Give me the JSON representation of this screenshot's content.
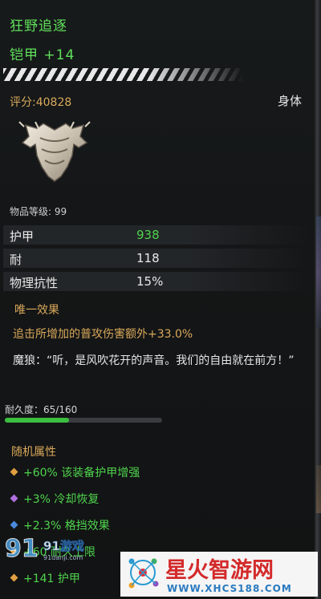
{
  "item": {
    "name": "狂野追逐",
    "subtype": "铠甲 +14",
    "score": "评分:40828",
    "slot": "身体",
    "item_level": "物品等级: 99"
  },
  "stats": [
    {
      "label": "护甲",
      "value": "938",
      "color": "#4fd44d"
    },
    {
      "label": "耐",
      "value": "118",
      "color": "#e8e8e8"
    },
    {
      "label": "物理抗性",
      "value": "15%",
      "color": "#e8e8e8"
    }
  ],
  "unique": {
    "header": "唯一效果",
    "effect": "追击所增加的普攻伤害额外+33.0%",
    "flavor": "魔狼：“听，是风吹花开的声音。我们的自由就在前方！”"
  },
  "durability": {
    "label": "耐久度：65/160",
    "fraction": 0.406
  },
  "random_affixes": {
    "header": "随机属性",
    "items": [
      {
        "text": "+60% 该装备护甲增强",
        "gem_color": "#e0a040"
      },
      {
        "text": "+3% 冷却恢复",
        "gem_color": "#b070e0"
      },
      {
        "text": "+2.3% 格挡效果",
        "gem_color": "#4a8ae0"
      },
      {
        "text": "+60 耐久上限",
        "gem_color": "#e0a040"
      },
      {
        "text": "+141 护甲",
        "gem_color": "#e0a040"
      }
    ]
  },
  "watermarks": {
    "left_logo": "91游戏",
    "left_logo_sub": "91danji.com",
    "right_title": "星火智游网",
    "right_url": "WWW.XHCS188.COM"
  }
}
